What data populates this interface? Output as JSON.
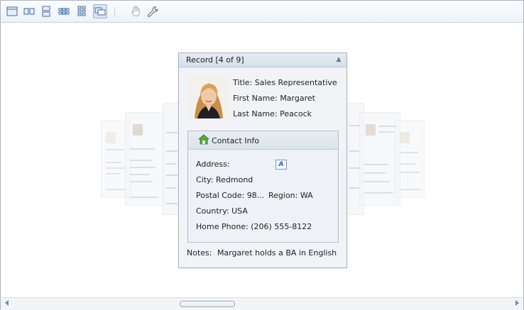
{
  "toolbar": {
    "buttons": [
      {
        "name": "single-record-view-button",
        "icon": "single-card-icon"
      },
      {
        "name": "two-columns-view-button",
        "icon": "two-cards-icon"
      },
      {
        "name": "two-rows-view-button",
        "icon": "two-rows-icon"
      },
      {
        "name": "columns-grid-view-button",
        "icon": "multi-column-grid-icon"
      },
      {
        "name": "rows-grid-view-button",
        "icon": "multi-row-grid-icon"
      },
      {
        "name": "carousel-view-button",
        "icon": "carousel-icon",
        "active": true
      },
      {
        "name": "pan-tool-button",
        "icon": "hand-icon"
      },
      {
        "name": "customize-button",
        "icon": "wrench-icon"
      }
    ]
  },
  "card": {
    "title": "Record [4 of 9]",
    "fields": {
      "title_label": "Title:",
      "title_value": "Sales Representative",
      "first_label": "First Name:",
      "first_value": "Margaret",
      "last_label": "Last Name:",
      "last_value": "Peacock"
    },
    "contact": {
      "group_title": "Contact Info",
      "address_label": "Address:",
      "city_label": "City:",
      "city_value": "Redmond",
      "postal_label": "Postal Code:",
      "postal_value": "98...",
      "region_label": "Region:",
      "region_value": "WA",
      "country_label": "Country:",
      "country_value": "USA",
      "phone_label": "Home Phone:",
      "phone_value": "(206) 555-8122"
    },
    "notes_label": "Notes:",
    "notes_value": "Margaret holds a BA in English"
  },
  "colors": {
    "accent": "#d9e4f2",
    "border": "#a7b3c2",
    "header": "#dde3eb"
  }
}
